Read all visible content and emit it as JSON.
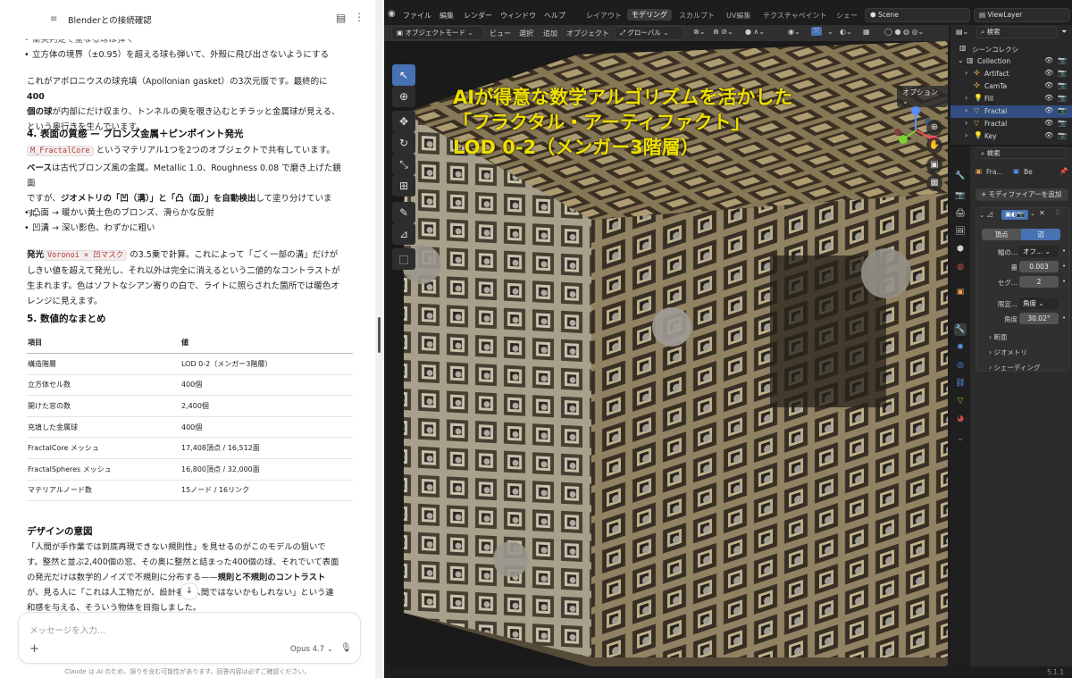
{
  "chat": {
    "header": {
      "title": "Blenderとの接続確認"
    },
    "bullet_top_1": "衝突判定で重なる球は弾く",
    "bullet_top_2": "立方体の境界（±0.95）を超える球も弾いて、外殻に飛び出さないようにする",
    "para_apollonian_1": "これがアポロニウスの球充填（Apollonian gasket）の3次元版です。最終的に",
    "para_apollonian_bold1": "400",
    "para_apollonian_bold2": "個の球",
    "para_apollonian_2": "が内部にだけ収まり、トンネルの奥を覗き込むとチラッと金属球が見える、",
    "para_apollonian_3": "という奥行きを生んでいます。",
    "section4_title": "4. 表面の質感 — ブロンズ金属＋ピンポイント発光",
    "material_code": "M_FractalCore",
    "material_text": "というマテリアル1つを2つのオブジェクトで共有しています。",
    "base_bold": "ベース",
    "base_text_1": "は古代ブロンズ風の金属。Metallic 1.0、Roughness 0.08 で磨き上げた鏡面",
    "base_text_2a": "ですが、",
    "base_text_2b": "ジオメトリの「凹（溝）」と「凸（面）」を自動検出",
    "base_text_2c": "して塗り分けていま",
    "base_text_3": "す。",
    "bullet_convex": "凸面 → 暖かい黄土色のブロンズ、滑らかな反射",
    "bullet_concave": "凹溝 → 深い影色、わずかに粗い",
    "emission_bold": "発光",
    "emission_code": "Voronoi × 凹マスク",
    "emission_text_1": "の3.5乗で計算。これによって「ごく一部の溝」だけが",
    "emission_text_2": "しきい値を超えて発光し、それ以外は完全に消えるという二値的なコントラストが",
    "emission_text_3": "生まれます。色はソフトなシアン寄りの白で、ライトに照らされた箇所では暖色オ",
    "emission_text_4": "レンジに見えます。",
    "section5_title": "5. 数値的なまとめ",
    "table": {
      "headers": [
        "項目",
        "値"
      ],
      "rows": [
        [
          "構造階層",
          "LOD 0-2（メンガー3階層）"
        ],
        [
          "立方体セル数",
          "400個"
        ],
        [
          "開けた窓の数",
          "2,400個"
        ],
        [
          "充填した金属球",
          "400個"
        ],
        [
          "FractalCore メッシュ",
          "17,408頂点 / 16,512面"
        ],
        [
          "FractalSpheres メッシュ",
          "16,800頂点 / 32,000面"
        ],
        [
          "マテリアルノード数",
          "15ノード / 16リンク"
        ]
      ]
    },
    "design_title": "デザインの意図",
    "design_1": "「人間が手作業では到底再現できない規則性」を見せるのがこのモデルの狙いで",
    "design_2": "す。整然と並ぶ2,400個の窓、その奥に整然と詰まった400個の球、それでいて表面",
    "design_3a": "の発光だけは数学的ノイズで不規則に分布する——",
    "design_3b": "規則と不規則のコントラスト",
    "design_4": "が、見る人に「これは人工物だが、設計者は人間ではないかもしれない」という違",
    "design_5": "和感を与える、そういう物体を目指しました。",
    "composer": {
      "placeholder": "メッセージを入力...",
      "model": "Opus 4.7"
    },
    "disclaimer": "Claude は AI のため、誤りを含む可能性があります。回答内容は必ずご確認ください。"
  },
  "blender": {
    "menus": [
      "ファイル",
      "編集",
      "レンダー",
      "ウィンドウ",
      "ヘルプ"
    ],
    "workspaces": [
      "レイアウト",
      "モデリング",
      "スカルプト",
      "UV編集",
      "テクスチャペイント",
      "シェー"
    ],
    "active_workspace": "モデリング",
    "scene": "Scene",
    "view_layer": "ViewLayer",
    "header": {
      "mode": "オブジェクトモード",
      "view": "ビュー",
      "select": "選択",
      "add": "追加",
      "object": "オブジェクト",
      "orientation": "グローバル",
      "options": "オプション"
    },
    "overlay_text": [
      "AIが得意な数学アルゴリズムを活かした",
      "「フラクタル・アーティファクト」",
      "LOD 0-2（メンガー3階層）"
    ],
    "outliner": {
      "search_placeholder": "検索",
      "scene_collection": "シーンコレクシ",
      "collection": "Collection",
      "items": [
        "Artifact",
        "CamTa",
        "Fill",
        "Fractal",
        "Fractal",
        "Key"
      ]
    },
    "properties": {
      "search_placeholder": "検索",
      "object_short": "Fra...",
      "modifier_short": "Be",
      "add_modifier": "+ モディファイアーを追加",
      "tab_vertex": "頂点",
      "tab_edge": "辺",
      "width_type_label": "幅の...",
      "width_type_value": "オフ...",
      "amount_label": "量",
      "amount_value": "0.003",
      "segments_label": "セグ...",
      "segments_value": "2",
      "limit_label": "限定...",
      "limit_value": "角度",
      "angle_label": "角度",
      "angle_value": "30.02°",
      "panels": [
        "断面",
        "ジオメトリ",
        "シェーディング"
      ]
    },
    "version": "5.1.1"
  }
}
